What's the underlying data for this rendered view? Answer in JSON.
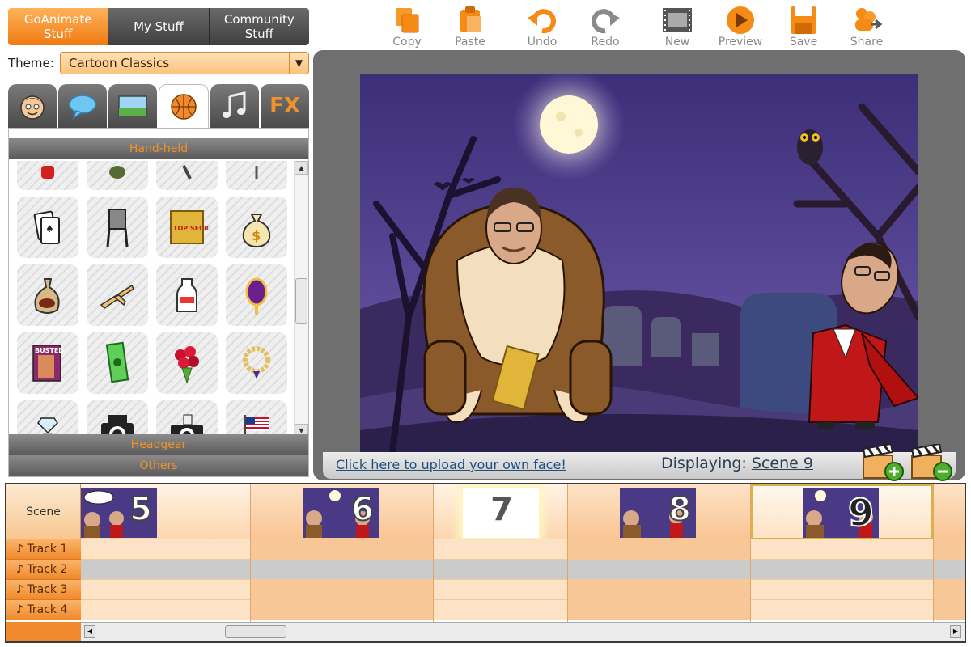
{
  "top_tabs": [
    {
      "label_line1": "GoAnimate",
      "label_line2": "Stuff",
      "active": true
    },
    {
      "label_line1": "My Stuff",
      "label_line2": "",
      "active": false
    },
    {
      "label_line1": "Community",
      "label_line2": "Stuff",
      "active": false
    }
  ],
  "theme": {
    "label": "Theme:",
    "value": "Cartoon Classics"
  },
  "category_tabs": [
    "character-icon",
    "speech-bubble-icon",
    "background-icon",
    "basketball-icon",
    "music-note-icon",
    "fx-icon"
  ],
  "fx_label": "FX",
  "asset_panel": {
    "section_top": "Hand-held",
    "section_headgear": "Headgear",
    "section_others": "Others",
    "items": [
      "lipstick",
      "grenade",
      "small-tool",
      "rod-tool",
      "playing-cards",
      "chair",
      "top-secret-envelope",
      "money-bag",
      "meat-bag",
      "airplane",
      "milk-bottle",
      "hand-mirror",
      "magazine",
      "dollar-bill",
      "rose-bouquet",
      "pearl-necklace",
      "diamond-ring",
      "camera",
      "camera-flash",
      "american-flag"
    ],
    "envelope_text": "TOP SECRET",
    "magazine_text": "BUSTED"
  },
  "toolbar": {
    "copy": "Copy",
    "paste": "Paste",
    "undo": "Undo",
    "redo": "Redo",
    "new": "New",
    "preview": "Preview",
    "save": "Save",
    "share": "Share"
  },
  "stage": {
    "upload_link": "Click here to upload your own face!",
    "displaying_label": "Displaying:",
    "current_scene": "Scene 9"
  },
  "timeline": {
    "scene_label": "Scene",
    "tracks": [
      "Track 1",
      "Track 2",
      "Track 3",
      "Track 4"
    ],
    "scenes": [
      {
        "number": "5"
      },
      {
        "number": "6"
      },
      {
        "number": "7"
      },
      {
        "number": "8"
      },
      {
        "number": "9"
      }
    ]
  },
  "colors": {
    "accent_orange": "#f07a12",
    "stage_frame": "#6f6f6f",
    "night_sky": "#4a3a86",
    "link_blue": "#1d4f7a"
  }
}
